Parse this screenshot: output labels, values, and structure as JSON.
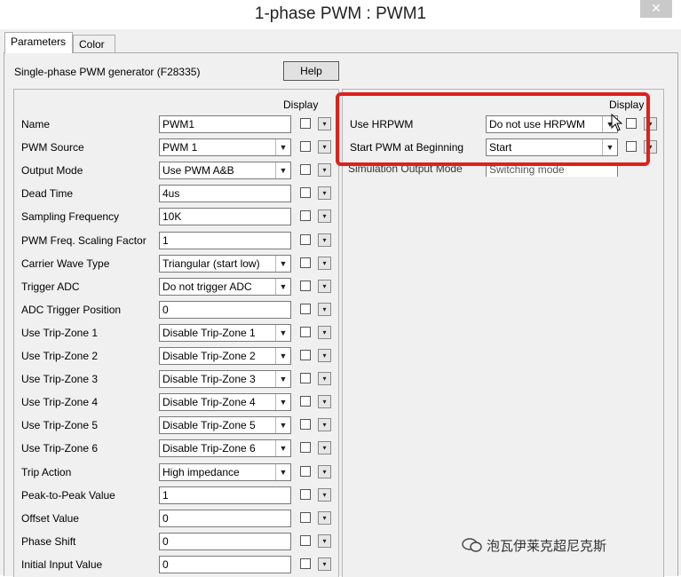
{
  "window": {
    "title": "1-phase PWM : PWM1",
    "close_label": "✕"
  },
  "tabs": [
    {
      "label": "Parameters",
      "active": true
    },
    {
      "label": "Color",
      "active": false
    }
  ],
  "description": "Single-phase PWM generator (F28335)",
  "help_label": "Help",
  "display_header": "Display",
  "left_params": [
    {
      "label": "Name",
      "value": "PWM1",
      "type": "text"
    },
    {
      "label": "PWM Source",
      "value": "PWM 1",
      "type": "select"
    },
    {
      "label": "Output Mode",
      "value": "Use PWM A&B",
      "type": "select"
    },
    {
      "label": "Dead Time",
      "value": "4us",
      "type": "text"
    },
    {
      "label": "Sampling Frequency",
      "value": "10K",
      "type": "text"
    },
    {
      "label": "PWM Freq. Scaling Factor",
      "value": "1",
      "type": "text"
    },
    {
      "label": "Carrier Wave Type",
      "value": "Triangular (start low)",
      "type": "select"
    },
    {
      "label": "Trigger ADC",
      "value": "Do not trigger ADC",
      "type": "select"
    },
    {
      "label": "ADC Trigger Position",
      "value": "0",
      "type": "text"
    },
    {
      "label": "Use Trip-Zone 1",
      "value": "Disable Trip-Zone 1",
      "type": "select"
    },
    {
      "label": "Use Trip-Zone 2",
      "value": "Disable Trip-Zone 2",
      "type": "select"
    },
    {
      "label": "Use Trip-Zone 3",
      "value": "Disable Trip-Zone 3",
      "type": "select"
    },
    {
      "label": "Use Trip-Zone 4",
      "value": "Disable Trip-Zone 4",
      "type": "select"
    },
    {
      "label": "Use Trip-Zone 5",
      "value": "Disable Trip-Zone 5",
      "type": "select"
    },
    {
      "label": "Use Trip-Zone 6",
      "value": "Disable Trip-Zone 6",
      "type": "select"
    },
    {
      "label": "Trip Action",
      "value": "High impedance",
      "type": "select"
    },
    {
      "label": "Peak-to-Peak Value",
      "value": "1",
      "type": "text"
    },
    {
      "label": "Offset Value",
      "value": "0",
      "type": "text"
    },
    {
      "label": "Phase Shift",
      "value": "0",
      "type": "text"
    },
    {
      "label": "Initial Input Value",
      "value": "0",
      "type": "text"
    }
  ],
  "right_params": [
    {
      "label": "Use HRPWM",
      "value": "Do not use HRPWM",
      "type": "select"
    },
    {
      "label": "Start PWM at Beginning",
      "value": "Start",
      "type": "select"
    }
  ],
  "partial_row": {
    "label": "Simulation Output Mode",
    "value": "Switching mode"
  },
  "watermark": "泡瓦伊莱克超尼克斯",
  "colors": {
    "highlight": "#e0201a",
    "dialog_bg": "#f0f0f0"
  }
}
